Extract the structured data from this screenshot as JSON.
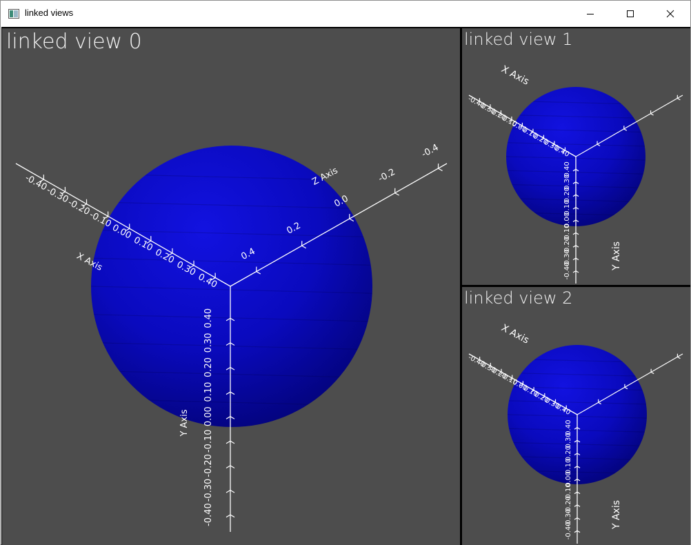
{
  "window": {
    "title": "linked views",
    "icon": "app-window-icon",
    "controls": [
      "minimize-icon",
      "maximize-icon",
      "close-icon"
    ]
  },
  "colors": {
    "background": "#4d4d4d",
    "sphere": "#0000c8",
    "axes": "#ffffff",
    "divider": "#000000"
  },
  "views": [
    {
      "label": "linked view 0",
      "x_axis": {
        "title": "X Axis",
        "ticks": [
          "-0.40",
          "-0.30",
          "-0.20",
          "-0.10",
          "0.00",
          "0.10",
          "0.20",
          "0.30",
          "0.40"
        ]
      },
      "y_axis": {
        "title": "Y Axis",
        "ticks": [
          "-0.40",
          "-0.30",
          "-0.20",
          "-0.10",
          "0.00",
          "0.10",
          "0.20",
          "0.30",
          "0.40"
        ]
      },
      "z_axis": {
        "title": "Z Axis",
        "ticks": [
          "0.4",
          "0.2",
          "0.0",
          "-0.2",
          "-0.4"
        ]
      }
    },
    {
      "label": "linked view 1",
      "x_axis": {
        "title": "X Axis",
        "ticks": [
          "-0.40",
          "-0.30",
          "-0.20",
          "-0.10",
          "0.00",
          "0.10",
          "0.20",
          "0.30",
          "0.40"
        ]
      },
      "y_axis": {
        "title": "Y Axis",
        "ticks": [
          "-0.40",
          "-0.30",
          "-0.20",
          "-0.10",
          "0.00",
          "0.10",
          "0.20",
          "0.30",
          "0.40"
        ]
      }
    },
    {
      "label": "linked view 2",
      "x_axis": {
        "title": "X Axis",
        "ticks": [
          "-0.40",
          "-0.30",
          "-0.20",
          "-0.10",
          "0.00",
          "0.10",
          "0.20",
          "0.30",
          "0.40"
        ]
      },
      "y_axis": {
        "title": "Y Axis",
        "ticks": [
          "-0.40",
          "-0.30",
          "-0.20",
          "-0.10",
          "0.00",
          "0.10",
          "0.20",
          "0.30",
          "0.40"
        ]
      }
    }
  ]
}
